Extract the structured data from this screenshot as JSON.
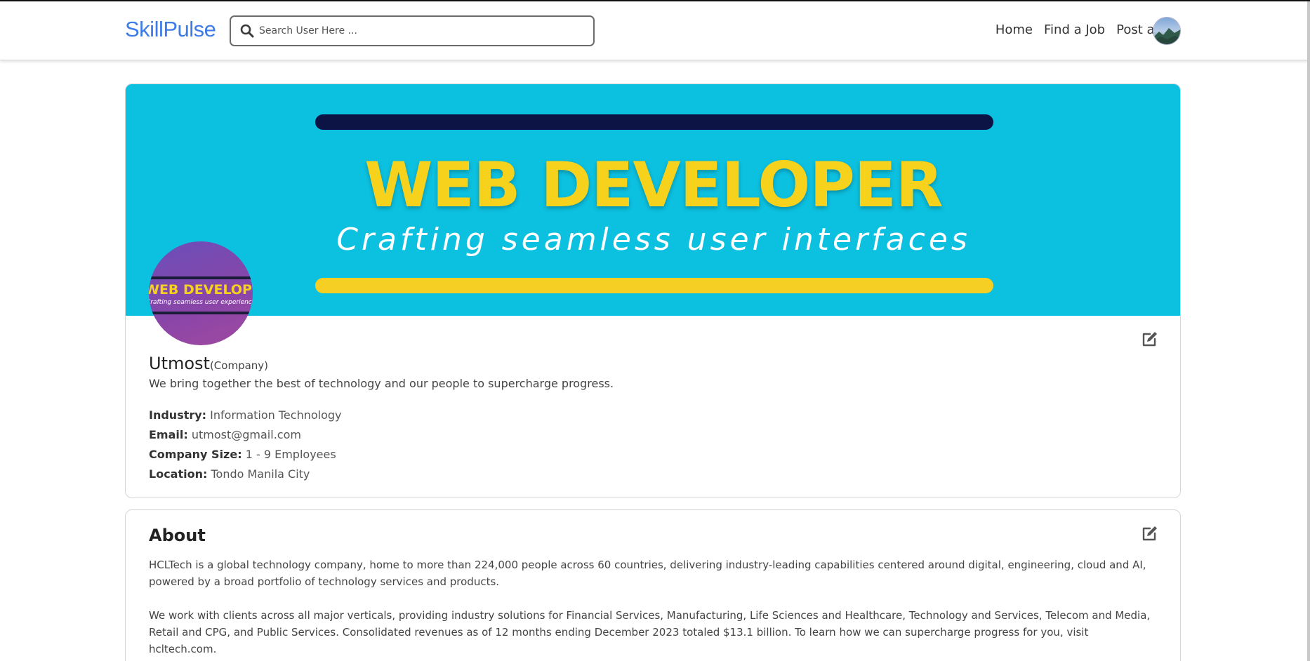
{
  "header": {
    "brand": "SkillPulse",
    "search_placeholder": "Search User Here ...",
    "nav": [
      "Home",
      "Find a Job",
      "Post a Job"
    ]
  },
  "banner": {
    "headline": "WEB DEVELOPER",
    "tagline": "Crafting seamless user interfaces",
    "colors": {
      "background": "#0cc0e0",
      "headline": "#f7d21c",
      "bar_top": "#0b1445",
      "bar_bottom": "#f5cf24"
    }
  },
  "logo": {
    "title": "WEB DEVELOPER",
    "subtitle": "Crafting seamless user experience"
  },
  "profile": {
    "name": "Utmost",
    "type": "(Company)",
    "description": "We bring together the best of technology and our people to supercharge progress.",
    "details": [
      {
        "label": "Industry:",
        "value": "Information Technology"
      },
      {
        "label": "Email:",
        "value": "utmost@gmail.com"
      },
      {
        "label": "Company Size:",
        "value": "1 - 9 Employees"
      },
      {
        "label": "Location:",
        "value": "Tondo Manila City"
      }
    ]
  },
  "about": {
    "title": "About",
    "paragraphs": [
      "HCLTech is a global technology company, home to more than 224,000 people across 60 countries, delivering industry-leading capabilities centered around digital, engineering, cloud and AI, powered by a broad portfolio of technology services and products.",
      "We work with clients across all major verticals, providing industry solutions for Financial Services, Manufacturing, Life Sciences and Healthcare, Technology and Services, Telecom and Media, Retail and CPG, and Public Services. Consolidated revenues as of 12 months ending December 2023 totaled $13.1 billion. To learn how we can supercharge progress for you, visit hcltech.com."
    ]
  },
  "icons": {
    "search": "search-icon",
    "edit": "edit-icon",
    "avatar": "user-avatar"
  },
  "theme": {
    "brand_color": "#3d7be6"
  }
}
